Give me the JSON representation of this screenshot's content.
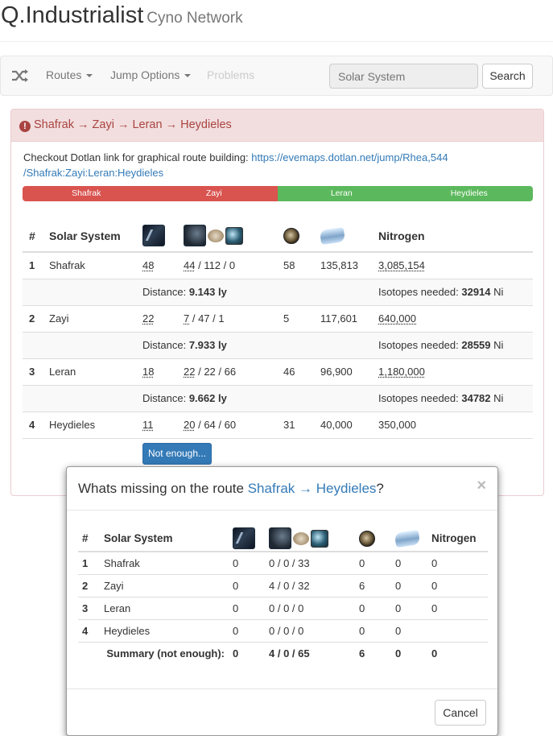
{
  "header": {
    "title": "Q.Industrialist",
    "subtitle": "Cyno Network"
  },
  "navbar": {
    "routes": "Routes",
    "jump_options": "Jump Options",
    "problems": "Problems",
    "search_placeholder": "Solar System",
    "search_button": "Search"
  },
  "panel": {
    "title": "Shafrak → Zayi → Leran → Heydieles",
    "text_prefix": "Checkout Dotlan link for graphical route building: ",
    "link_line1": "https://evemaps.dotlan.net/jump/Rhea,544",
    "link_line2": "/Shafrak:Zayi:Leran:Heydieles",
    "segments": [
      "Shafrak",
      "Zayi",
      "Leran",
      "Heydieles"
    ],
    "segment_colors": [
      "#d9534f",
      "#d9534f",
      "#5cb85c",
      "#5cb85c"
    ],
    "table": {
      "headers": {
        "num": "#",
        "system": "Solar System",
        "nitrogen": "Nitrogen"
      },
      "rows": [
        {
          "num": "1",
          "system": "Shafrak",
          "ships": "48",
          "fuel": "44",
          "liq": "112",
          "ore": "0",
          "stront": "58",
          "nitro": "135,813",
          "nitrogen": "3,085,154"
        },
        {
          "num": "2",
          "system": "Zayi",
          "ships": "22",
          "fuel": "7",
          "liq": "47",
          "ore": "1",
          "stront": "5",
          "nitro": "117,601",
          "nitrogen": "640,000"
        },
        {
          "num": "3",
          "system": "Leran",
          "ships": "18",
          "fuel": "22",
          "liq": "22",
          "ore": "66",
          "stront": "46",
          "nitro": "96,900",
          "nitrogen": "1,180,000"
        },
        {
          "num": "4",
          "system": "Heydieles",
          "ships": "11",
          "fuel": "20",
          "liq": "64",
          "ore": "60",
          "stront": "31",
          "nitro": "40,000",
          "nitrogen": "350,000"
        }
      ],
      "distances": [
        {
          "label": "Distance: ",
          "value": "9.143 ly",
          "iso_label": "Isotopes needed: ",
          "iso_value": "32914",
          "iso_unit": " Ni"
        },
        {
          "label": "Distance: ",
          "value": "7.933 ly",
          "iso_label": "Isotopes needed: ",
          "iso_value": "28559",
          "iso_unit": " Ni"
        },
        {
          "label": "Distance: ",
          "value": "9.662 ly",
          "iso_label": "Isotopes needed: ",
          "iso_value": "34782",
          "iso_unit": " Ni"
        }
      ]
    },
    "button": "Not enough..."
  },
  "modal": {
    "title_prefix": "Whats missing on the route ",
    "title_link": "Shafrak → Heydieles",
    "title_suffix": "?",
    "close": "×",
    "headers": {
      "num": "#",
      "system": "Solar System",
      "nitrogen": "Nitrogen"
    },
    "rows": [
      {
        "num": "1",
        "system": "Shafrak",
        "ships": "0",
        "fuel": "0 / 0 / 33",
        "stront": "0",
        "nitro": "0",
        "nitrogen": "0"
      },
      {
        "num": "2",
        "system": "Zayi",
        "ships": "0",
        "fuel": "4 / 0 / 32",
        "stront": "6",
        "nitro": "0",
        "nitrogen": "0"
      },
      {
        "num": "3",
        "system": "Leran",
        "ships": "0",
        "fuel": "0 / 0 / 0",
        "stront": "0",
        "nitro": "0",
        "nitrogen": "0"
      },
      {
        "num": "4",
        "system": "Heydieles",
        "ships": "0",
        "fuel": "0 / 0 / 0",
        "stront": "0",
        "nitro": "0",
        "nitrogen": ""
      }
    ],
    "summary": {
      "label": "Summary (not enough):",
      "ships": "0",
      "fuel": "4 / 0 / 65",
      "stront": "6",
      "nitro": "0",
      "nitrogen": "0"
    },
    "cancel": "Cancel"
  }
}
